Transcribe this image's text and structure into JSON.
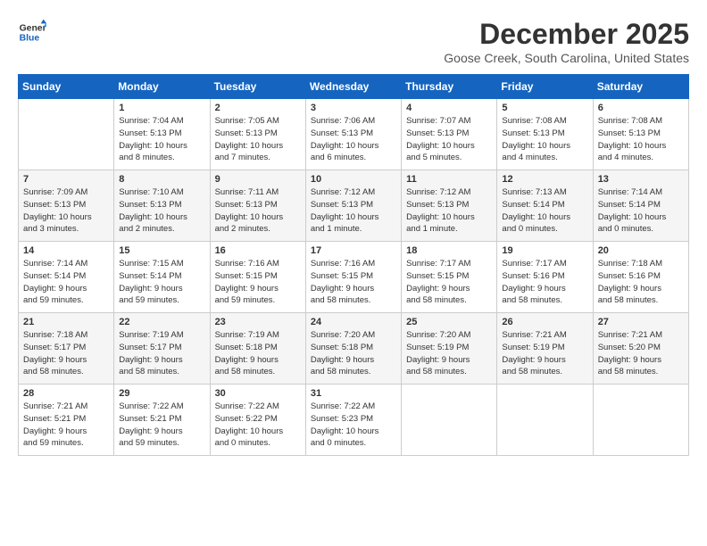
{
  "logo": {
    "line1": "General",
    "line2": "Blue"
  },
  "title": "December 2025",
  "subtitle": "Goose Creek, South Carolina, United States",
  "weekdays": [
    "Sunday",
    "Monday",
    "Tuesday",
    "Wednesday",
    "Thursday",
    "Friday",
    "Saturday"
  ],
  "weeks": [
    [
      {
        "day": "",
        "info": ""
      },
      {
        "day": "1",
        "info": "Sunrise: 7:04 AM\nSunset: 5:13 PM\nDaylight: 10 hours\nand 8 minutes."
      },
      {
        "day": "2",
        "info": "Sunrise: 7:05 AM\nSunset: 5:13 PM\nDaylight: 10 hours\nand 7 minutes."
      },
      {
        "day": "3",
        "info": "Sunrise: 7:06 AM\nSunset: 5:13 PM\nDaylight: 10 hours\nand 6 minutes."
      },
      {
        "day": "4",
        "info": "Sunrise: 7:07 AM\nSunset: 5:13 PM\nDaylight: 10 hours\nand 5 minutes."
      },
      {
        "day": "5",
        "info": "Sunrise: 7:08 AM\nSunset: 5:13 PM\nDaylight: 10 hours\nand 4 minutes."
      },
      {
        "day": "6",
        "info": "Sunrise: 7:08 AM\nSunset: 5:13 PM\nDaylight: 10 hours\nand 4 minutes."
      }
    ],
    [
      {
        "day": "7",
        "info": "Sunrise: 7:09 AM\nSunset: 5:13 PM\nDaylight: 10 hours\nand 3 minutes."
      },
      {
        "day": "8",
        "info": "Sunrise: 7:10 AM\nSunset: 5:13 PM\nDaylight: 10 hours\nand 2 minutes."
      },
      {
        "day": "9",
        "info": "Sunrise: 7:11 AM\nSunset: 5:13 PM\nDaylight: 10 hours\nand 2 minutes."
      },
      {
        "day": "10",
        "info": "Sunrise: 7:12 AM\nSunset: 5:13 PM\nDaylight: 10 hours\nand 1 minute."
      },
      {
        "day": "11",
        "info": "Sunrise: 7:12 AM\nSunset: 5:13 PM\nDaylight: 10 hours\nand 1 minute."
      },
      {
        "day": "12",
        "info": "Sunrise: 7:13 AM\nSunset: 5:14 PM\nDaylight: 10 hours\nand 0 minutes."
      },
      {
        "day": "13",
        "info": "Sunrise: 7:14 AM\nSunset: 5:14 PM\nDaylight: 10 hours\nand 0 minutes."
      }
    ],
    [
      {
        "day": "14",
        "info": "Sunrise: 7:14 AM\nSunset: 5:14 PM\nDaylight: 9 hours\nand 59 minutes."
      },
      {
        "day": "15",
        "info": "Sunrise: 7:15 AM\nSunset: 5:14 PM\nDaylight: 9 hours\nand 59 minutes."
      },
      {
        "day": "16",
        "info": "Sunrise: 7:16 AM\nSunset: 5:15 PM\nDaylight: 9 hours\nand 59 minutes."
      },
      {
        "day": "17",
        "info": "Sunrise: 7:16 AM\nSunset: 5:15 PM\nDaylight: 9 hours\nand 58 minutes."
      },
      {
        "day": "18",
        "info": "Sunrise: 7:17 AM\nSunset: 5:15 PM\nDaylight: 9 hours\nand 58 minutes."
      },
      {
        "day": "19",
        "info": "Sunrise: 7:17 AM\nSunset: 5:16 PM\nDaylight: 9 hours\nand 58 minutes."
      },
      {
        "day": "20",
        "info": "Sunrise: 7:18 AM\nSunset: 5:16 PM\nDaylight: 9 hours\nand 58 minutes."
      }
    ],
    [
      {
        "day": "21",
        "info": "Sunrise: 7:18 AM\nSunset: 5:17 PM\nDaylight: 9 hours\nand 58 minutes."
      },
      {
        "day": "22",
        "info": "Sunrise: 7:19 AM\nSunset: 5:17 PM\nDaylight: 9 hours\nand 58 minutes."
      },
      {
        "day": "23",
        "info": "Sunrise: 7:19 AM\nSunset: 5:18 PM\nDaylight: 9 hours\nand 58 minutes."
      },
      {
        "day": "24",
        "info": "Sunrise: 7:20 AM\nSunset: 5:18 PM\nDaylight: 9 hours\nand 58 minutes."
      },
      {
        "day": "25",
        "info": "Sunrise: 7:20 AM\nSunset: 5:19 PM\nDaylight: 9 hours\nand 58 minutes."
      },
      {
        "day": "26",
        "info": "Sunrise: 7:21 AM\nSunset: 5:19 PM\nDaylight: 9 hours\nand 58 minutes."
      },
      {
        "day": "27",
        "info": "Sunrise: 7:21 AM\nSunset: 5:20 PM\nDaylight: 9 hours\nand 58 minutes."
      }
    ],
    [
      {
        "day": "28",
        "info": "Sunrise: 7:21 AM\nSunset: 5:21 PM\nDaylight: 9 hours\nand 59 minutes."
      },
      {
        "day": "29",
        "info": "Sunrise: 7:22 AM\nSunset: 5:21 PM\nDaylight: 9 hours\nand 59 minutes."
      },
      {
        "day": "30",
        "info": "Sunrise: 7:22 AM\nSunset: 5:22 PM\nDaylight: 10 hours\nand 0 minutes."
      },
      {
        "day": "31",
        "info": "Sunrise: 7:22 AM\nSunset: 5:23 PM\nDaylight: 10 hours\nand 0 minutes."
      },
      {
        "day": "",
        "info": ""
      },
      {
        "day": "",
        "info": ""
      },
      {
        "day": "",
        "info": ""
      }
    ]
  ]
}
